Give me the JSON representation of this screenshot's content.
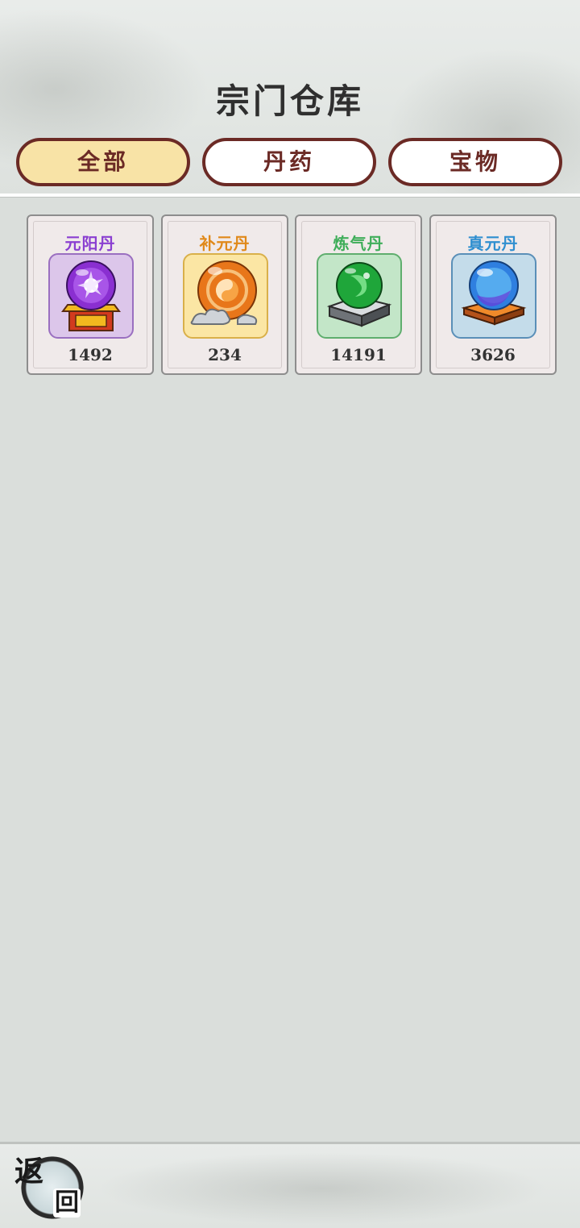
{
  "header": {
    "title": "宗门仓库"
  },
  "tabs": [
    {
      "label": "全部",
      "active": true
    },
    {
      "label": "丹药",
      "active": false
    },
    {
      "label": "宝物",
      "active": false
    }
  ],
  "items": [
    {
      "name": "元阳丹",
      "count": "1492",
      "name_color": "#8a3fd1",
      "icon": "purple-orb-on-gold-stand-icon",
      "box_bg": "#dcc6ea",
      "box_border": "#9a6fc0"
    },
    {
      "name": "补元丹",
      "count": "234",
      "name_color": "#e0891a",
      "icon": "orange-orb-on-cloud-icon",
      "box_bg": "#fbe6a4",
      "box_border": "#d9b04a"
    },
    {
      "name": "炼气丹",
      "count": "14191",
      "name_color": "#3fae5a",
      "icon": "green-orb-on-stone-base-icon",
      "box_bg": "#c3e6c8",
      "box_border": "#5fae6e"
    },
    {
      "name": "真元丹",
      "count": "3626",
      "name_color": "#2f8fd0",
      "icon": "blue-orb-on-wooden-base-icon",
      "box_bg": "#c4dcea",
      "box_border": "#5a8fb8"
    }
  ],
  "footer": {
    "back_label_top": "返",
    "back_label_bottom": "回"
  }
}
